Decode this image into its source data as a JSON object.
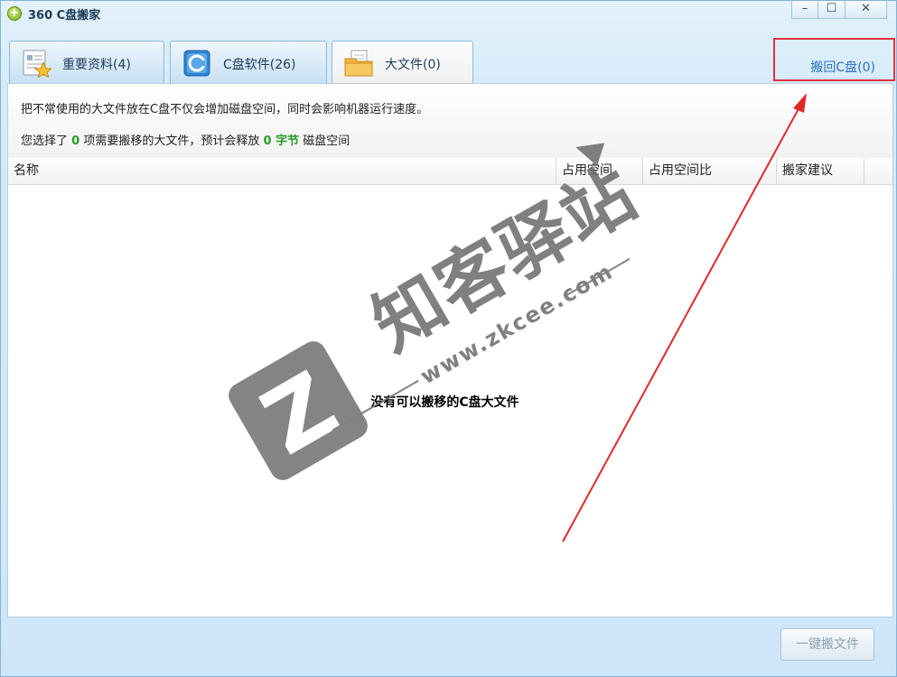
{
  "window": {
    "title": "360 C盘搬家",
    "logo_glyph": "+",
    "controls": {
      "minimize": "–",
      "maximize": "☐",
      "close": "✕"
    }
  },
  "tabs": [
    {
      "label": "重要资料(4)",
      "icon": "document-star-icon",
      "active": false
    },
    {
      "label": "C盘软件(26)",
      "icon": "c-drive-app-icon",
      "active": false
    },
    {
      "label": "大文件(0)",
      "icon": "folder-files-icon",
      "active": true
    }
  ],
  "restore_link": {
    "label": "搬回C盘(0)"
  },
  "info": {
    "line1": "把不常使用的大文件放在C盘不仅会增加磁盘空间，同时会影响机器运行速度。",
    "line2_prefix": "您选择了",
    "selected_count": "0",
    "line2_middle": "项需要搬移的大文件，预计会释放",
    "release_amount": "0 字节",
    "line2_suffix": "磁盘空间"
  },
  "table": {
    "columns": [
      "名称",
      "占用空间",
      "占用空间比",
      "搬家建议"
    ],
    "rows": [],
    "empty_message": "没有可以搬移的C盘大文件"
  },
  "footer": {
    "onekey_button": "一键搬文件"
  },
  "watermark": {
    "brand": "知客驿站",
    "url": "www.zkcee.com",
    "letter": "Z"
  },
  "colors": {
    "accent_blue": "#2b73c2",
    "highlight_red": "#e0323a",
    "count_green": "#2d9a27",
    "title_blue": "#1d3b5a"
  }
}
